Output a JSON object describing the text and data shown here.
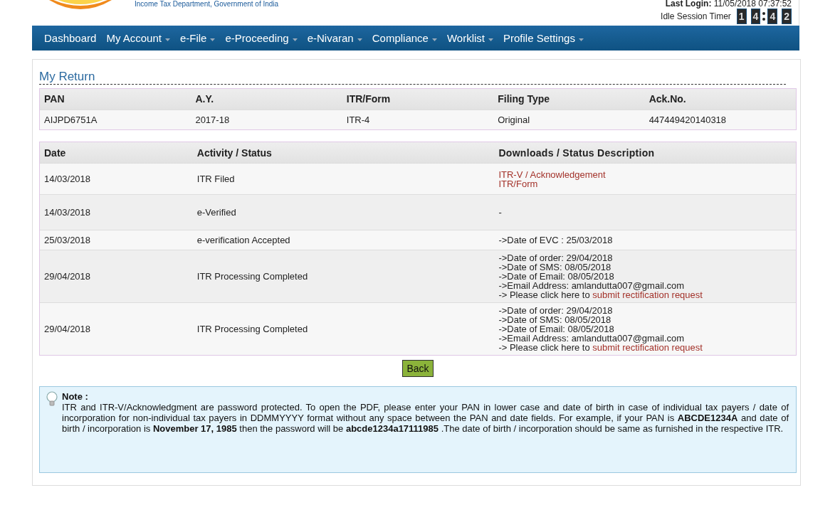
{
  "header": {
    "department": "Income Tax Department, Government of India",
    "last_login_label": "Last Login:",
    "last_login": "11/05/2018 07:37:52",
    "timer_label": "Idle Session Timer",
    "timer_digits": [
      "1",
      "4",
      "4",
      "2"
    ]
  },
  "nav": [
    {
      "label": "Dashboard",
      "dropdown": false
    },
    {
      "label": "My Account",
      "dropdown": true
    },
    {
      "label": "e-File",
      "dropdown": true
    },
    {
      "label": "e-Proceeding",
      "dropdown": true
    },
    {
      "label": "e-Nivaran",
      "dropdown": true
    },
    {
      "label": "Compliance",
      "dropdown": true
    },
    {
      "label": "Worklist",
      "dropdown": true
    },
    {
      "label": "Profile Settings",
      "dropdown": true
    }
  ],
  "title": "My Return",
  "summary": {
    "columns": [
      "PAN",
      "A.Y.",
      "ITR/Form",
      "Filing Type",
      "Ack.No."
    ],
    "row": [
      "AIJPD6751A",
      "2017-18",
      "ITR-4",
      "Original",
      "447449420140318"
    ]
  },
  "activity": {
    "columns": [
      "Date",
      "Activity / Status",
      "Downloads / Status Description"
    ],
    "rows": [
      {
        "date": "14/03/2018",
        "activity": "ITR Filed",
        "lines": [
          {
            "link": "ITR-V / Acknowledgement"
          },
          {
            "link": "ITR/Form"
          }
        ]
      },
      {
        "date": "14/03/2018",
        "activity": "e-Verified",
        "lines": [
          {
            "text": "-"
          }
        ]
      },
      {
        "date": "25/03/2018",
        "activity": "e-verification Accepted",
        "lines": [
          {
            "text": "->Date of EVC : 25/03/2018"
          }
        ]
      },
      {
        "date": "29/04/2018",
        "activity": "ITR Processing Completed",
        "lines": [
          {
            "text": "->Date of order: 29/04/2018"
          },
          {
            "text": "->Date of SMS: 08/05/2018"
          },
          {
            "text": "->Date of Email: 08/05/2018"
          },
          {
            "text": "->Email Address: amlandutta007@gmail.com"
          },
          {
            "text": "-> Please click here to",
            "link": "submit rectification request"
          }
        ]
      },
      {
        "date": "29/04/2018",
        "activity": "ITR Processing Completed",
        "lines": [
          {
            "text": "->Date of order: 29/04/2018"
          },
          {
            "text": "->Date of SMS: 08/05/2018"
          },
          {
            "text": "->Date of Email: 08/05/2018"
          },
          {
            "text": "->Email Address: amlandutta007@gmail.com"
          },
          {
            "text": "-> Please click here to",
            "link": "submit rectification request"
          }
        ]
      }
    ]
  },
  "back_button": "Back",
  "note": {
    "heading": "Note :",
    "text": "ITR and ITR-V/Acknowledgment are password protected. To open the PDF, please enter your PAN in lower case and date of birth in case of individual tax payers / date of incorporation for non-individual tax payers in DDMMYYYY format without any space between the PAN and date fields. For example, if your PAN is **ABCDE1234A** and date of birth / incorporation is **November 17, 1985** then the password will be **abcde1234a17111985** .The date of birth / incorporation should be same as furnished in the respective ITR."
  }
}
